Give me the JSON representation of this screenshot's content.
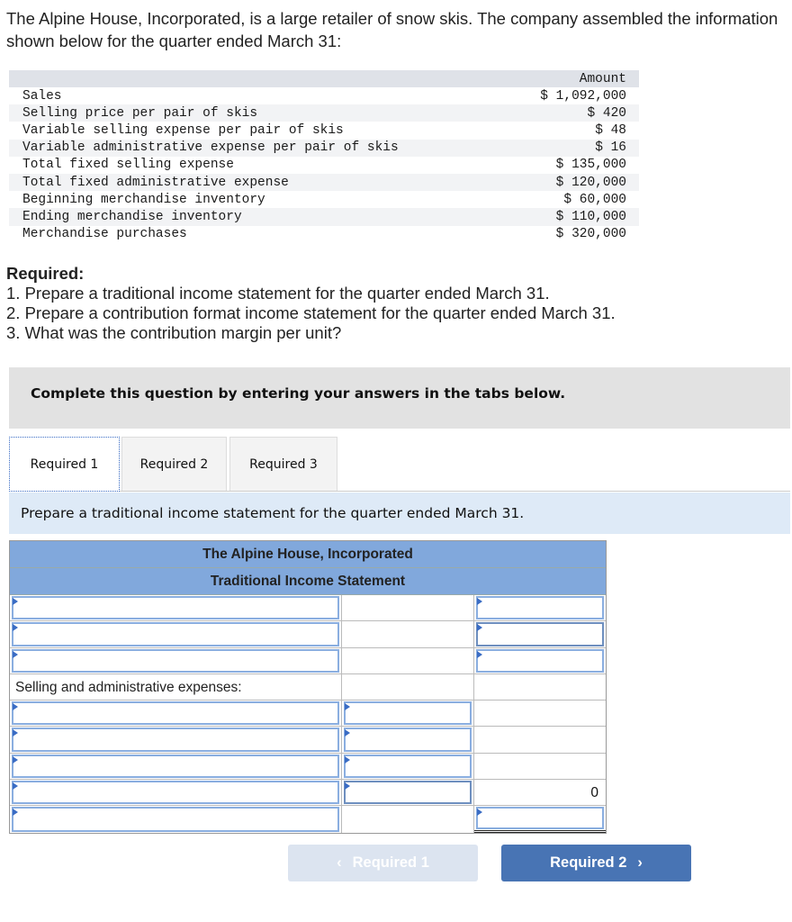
{
  "intro": "The Alpine House, Incorporated, is a large retailer of snow skis. The company assembled the information shown below for the quarter ended March 31:",
  "data_table": {
    "column_header": "Amount",
    "rows": [
      {
        "label": "Sales",
        "value": "$ 1,092,000"
      },
      {
        "label": "Selling price per pair of skis",
        "value": "$ 420"
      },
      {
        "label": "Variable selling expense per pair of skis",
        "value": "$ 48"
      },
      {
        "label": "Variable administrative expense per pair of skis",
        "value": "$ 16"
      },
      {
        "label": "Total fixed selling expense",
        "value": "$ 135,000"
      },
      {
        "label": "Total fixed administrative expense",
        "value": "$ 120,000"
      },
      {
        "label": "Beginning merchandise inventory",
        "value": "$ 60,000"
      },
      {
        "label": "Ending merchandise inventory",
        "value": "$ 110,000"
      },
      {
        "label": "Merchandise purchases",
        "value": "$ 320,000"
      }
    ]
  },
  "required": {
    "heading": "Required:",
    "items": [
      "1. Prepare a traditional income statement for the quarter ended March 31.",
      "2. Prepare a contribution format income statement for the quarter ended March 31.",
      "3. What was the contribution margin per unit?"
    ]
  },
  "banner": "Complete this question by entering your answers in the tabs below.",
  "tabs": [
    {
      "label": "Required 1",
      "active": true
    },
    {
      "label": "Required 2",
      "active": false
    },
    {
      "label": "Required 3",
      "active": false
    }
  ],
  "instruction": "Prepare a traditional income statement for the quarter ended March 31.",
  "statement": {
    "company": "The Alpine House, Incorporated",
    "title": "Traditional Income Statement",
    "section_label": "Selling and administrative expenses:",
    "total_value": "0"
  },
  "buttons": {
    "prev_label": "Required 1",
    "next_label": "Required 2",
    "prev_icon": "‹",
    "next_icon": "›"
  }
}
